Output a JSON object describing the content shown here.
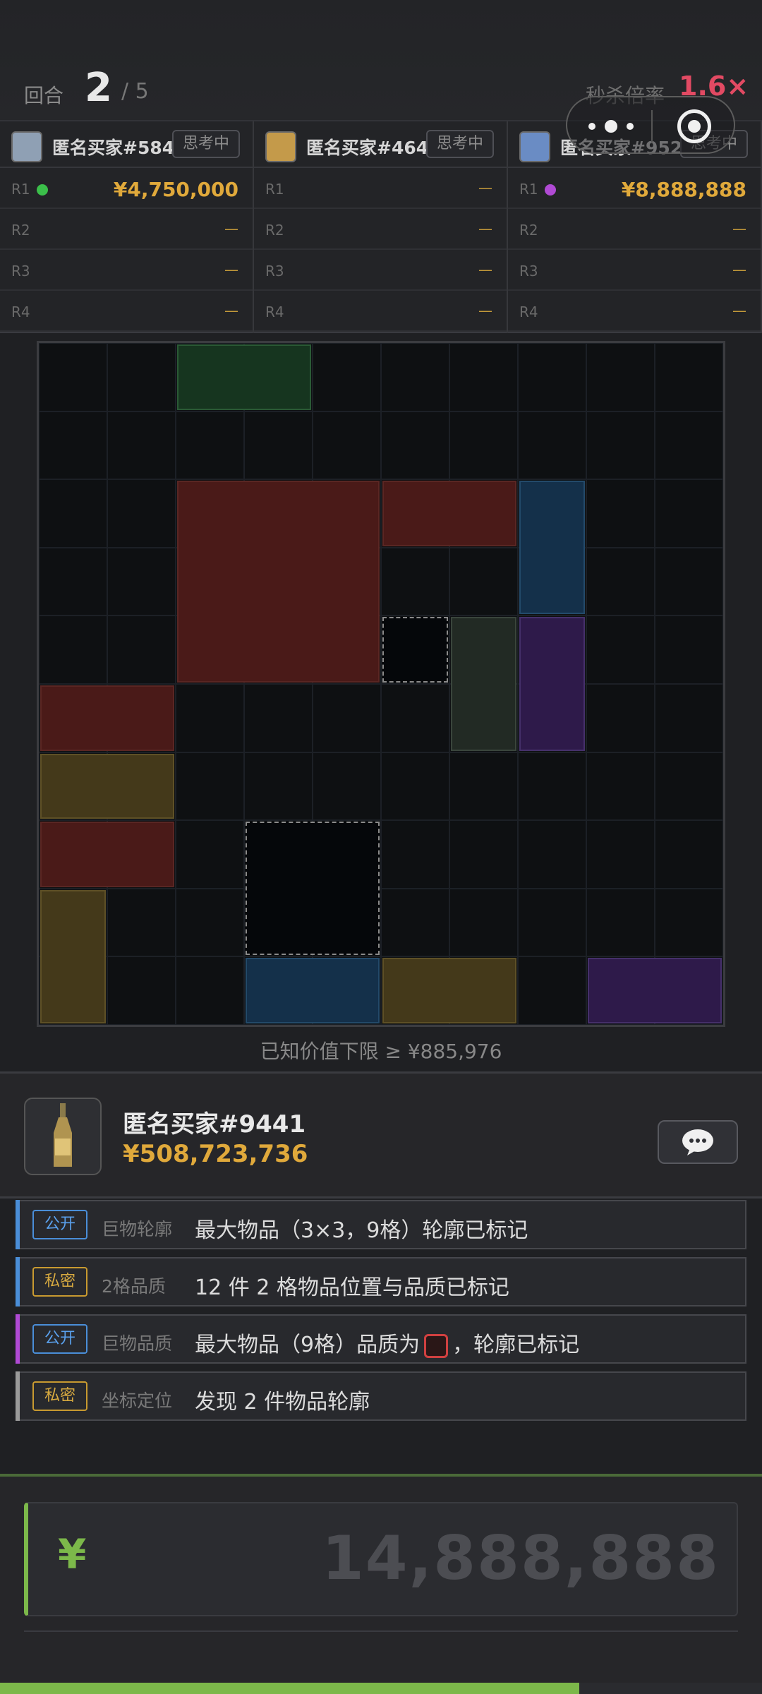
{
  "header": {
    "round_label": "回合",
    "round_current": "2",
    "round_total": "/ 5",
    "multiplier_label": "秒杀倍率",
    "multiplier_value": "1.6×"
  },
  "buyers": [
    {
      "name": "匿名买家#584",
      "status": "思考中",
      "avatar_color": "#8fa0b4",
      "bids": [
        {
          "label": "R1",
          "amount": "¥4,750,000",
          "dot": "#3bbf4a"
        },
        {
          "label": "R2",
          "amount": "—"
        },
        {
          "label": "R3",
          "amount": "—"
        },
        {
          "label": "R4",
          "amount": "—"
        }
      ]
    },
    {
      "name": "匿名买家#464",
      "status": "思考中",
      "avatar_color": "#c49a4a",
      "bids": [
        {
          "label": "R1",
          "amount": "—"
        },
        {
          "label": "R2",
          "amount": "—"
        },
        {
          "label": "R3",
          "amount": "—"
        },
        {
          "label": "R4",
          "amount": "—"
        }
      ]
    },
    {
      "name": "匿名买家#952",
      "status": "思考中",
      "avatar_color": "#6a8cc4",
      "bids": [
        {
          "label": "R1",
          "amount": "¥8,888,888",
          "dot": "#b04ad4"
        },
        {
          "label": "R2",
          "amount": "—"
        },
        {
          "label": "R3",
          "amount": "—"
        },
        {
          "label": "R4",
          "amount": "—"
        }
      ]
    }
  ],
  "board": {
    "cols": 10,
    "rows": 10,
    "items": [
      {
        "c": 2,
        "r": 0,
        "w": 2,
        "h": 1,
        "color": "green"
      },
      {
        "c": 2,
        "r": 2,
        "w": 3,
        "h": 3,
        "color": "red"
      },
      {
        "c": 5,
        "r": 2,
        "w": 2,
        "h": 1,
        "color": "red"
      },
      {
        "c": 7,
        "r": 2,
        "w": 1,
        "h": 2,
        "color": "blue"
      },
      {
        "c": 6,
        "r": 4,
        "w": 1,
        "h": 2,
        "color": "gray"
      },
      {
        "c": 7,
        "r": 4,
        "w": 1,
        "h": 2,
        "color": "purple"
      },
      {
        "c": 0,
        "r": 5,
        "w": 2,
        "h": 1,
        "color": "red"
      },
      {
        "c": 0,
        "r": 6,
        "w": 2,
        "h": 1,
        "color": "gold"
      },
      {
        "c": 0,
        "r": 7,
        "w": 2,
        "h": 1,
        "color": "red"
      },
      {
        "c": 0,
        "r": 8,
        "w": 1,
        "h": 2,
        "color": "gold"
      },
      {
        "c": 3,
        "r": 9,
        "w": 2,
        "h": 1,
        "color": "blue"
      },
      {
        "c": 5,
        "r": 9,
        "w": 2,
        "h": 1,
        "color": "gold"
      },
      {
        "c": 8,
        "r": 9,
        "w": 2,
        "h": 1,
        "color": "purple"
      }
    ],
    "outlines": [
      {
        "c": 5,
        "r": 4,
        "w": 1,
        "h": 1
      },
      {
        "c": 3,
        "r": 7,
        "w": 2,
        "h": 2
      }
    ],
    "palette": {
      "green": [
        "#16351f",
        "#2a5a35"
      ],
      "red": [
        "#4a1a18",
        "#5a2623"
      ],
      "blue": [
        "#14304a",
        "#234a6a"
      ],
      "gray": [
        "#222a24",
        "#3a453c"
      ],
      "purple": [
        "#2e1a4a",
        "#45306a"
      ],
      "gold": [
        "#44391a",
        "#5e5026"
      ]
    }
  },
  "low_bound": "已知价值下限 ≥ ¥885,976",
  "player": {
    "name": "匿名买家#9441",
    "money": "¥508,723,736",
    "chat_icon": "chat-bubble-icon"
  },
  "clues": [
    {
      "tag": "公开",
      "kind": "pub",
      "bar": "#4a8ed8",
      "category": "巨物轮廓",
      "text": "最大物品（3×3，9格）轮廓已标记"
    },
    {
      "tag": "私密",
      "kind": "pri",
      "bar": "#4a8ed8",
      "category": "2格品质",
      "text": "12 件 2 格物品位置与品质已标记"
    },
    {
      "tag": "公开",
      "kind": "pub",
      "bar": "#b04ad4",
      "category": "巨物品质",
      "text_before": "最大物品（9格）品质为",
      "text_after": "，轮廓已标记"
    },
    {
      "tag": "私密",
      "kind": "pri",
      "bar": "#9a9a9a",
      "category": "坐标定位",
      "text": "发现 2 件物品轮廓"
    }
  ],
  "bid_input": {
    "currency": "¥",
    "placeholder": "14,888,888",
    "progress": 0.76
  }
}
